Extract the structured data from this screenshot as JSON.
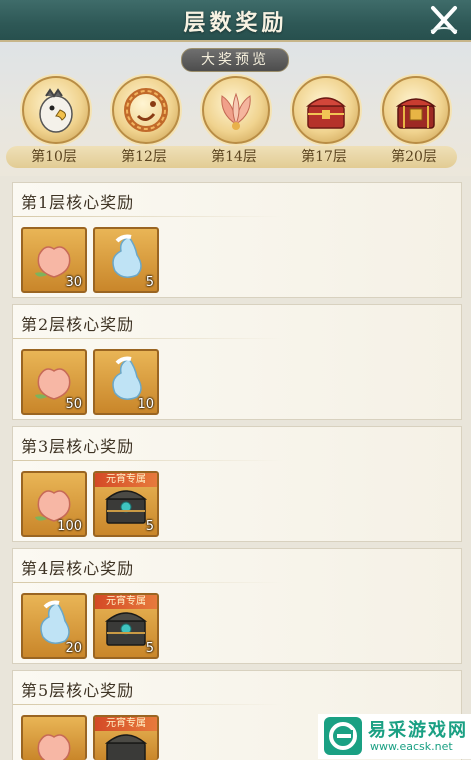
{
  "header": {
    "title": "层数奖励"
  },
  "preview": {
    "banner": "大奖预览",
    "prizes": [
      {
        "floor": "第10层",
        "icon": "eagle-prize-icon"
      },
      {
        "floor": "第12层",
        "icon": "dragon-ring-prize-icon"
      },
      {
        "floor": "第14层",
        "icon": "lotus-prize-icon"
      },
      {
        "floor": "第17层",
        "icon": "red-chest-prize-icon"
      },
      {
        "floor": "第20层",
        "icon": "treasure-chest-prize-icon"
      }
    ]
  },
  "rewards": [
    {
      "title": "第1层核心奖励",
      "items": [
        {
          "icon": "peach-icon",
          "count": "30",
          "tag": ""
        },
        {
          "icon": "spirit-gourd-icon",
          "count": "5",
          "tag": ""
        }
      ]
    },
    {
      "title": "第2层核心奖励",
      "items": [
        {
          "icon": "peach-icon",
          "count": "50",
          "tag": ""
        },
        {
          "icon": "spirit-gourd-icon",
          "count": "10",
          "tag": ""
        }
      ]
    },
    {
      "title": "第3层核心奖励",
      "items": [
        {
          "icon": "peach-icon",
          "count": "100",
          "tag": ""
        },
        {
          "icon": "jade-chest-icon",
          "count": "5",
          "tag": "元宵专属"
        }
      ]
    },
    {
      "title": "第4层核心奖励",
      "items": [
        {
          "icon": "spirit-gourd-icon",
          "count": "20",
          "tag": ""
        },
        {
          "icon": "jade-chest-icon",
          "count": "5",
          "tag": "元宵专属"
        }
      ]
    },
    {
      "title": "第5层核心奖励",
      "items": [
        {
          "icon": "peach-icon",
          "count": "",
          "tag": ""
        },
        {
          "icon": "jade-chest-icon",
          "count": "",
          "tag": "元宵专属"
        }
      ]
    }
  ],
  "watermark": {
    "name": "易采游戏网",
    "url": "www.eacsk.net"
  }
}
